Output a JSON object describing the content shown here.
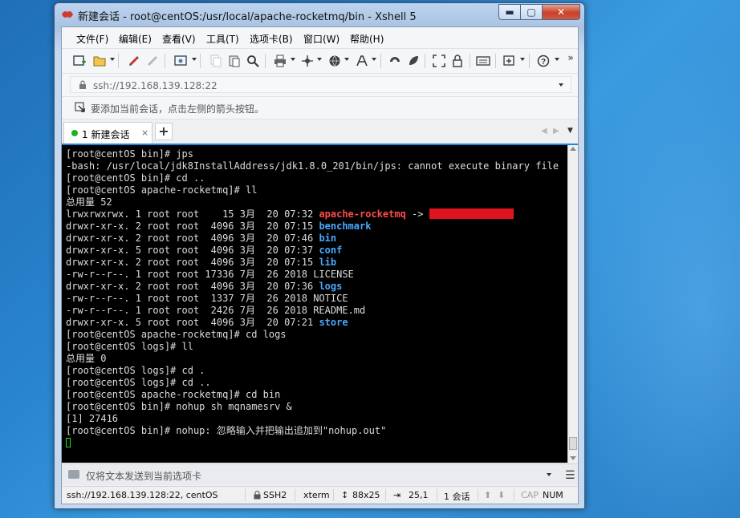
{
  "window": {
    "title": "新建会话 - root@centOS:/usr/local/apache-rocketmq/bin - Xshell 5",
    "controls": {
      "minimize": "▬",
      "maximize": "▢",
      "close": "✕"
    }
  },
  "menu": {
    "items": [
      "文件(F)",
      "编辑(E)",
      "查看(V)",
      "工具(T)",
      "选项卡(B)",
      "窗口(W)",
      "帮助(H)"
    ]
  },
  "toolbar": {
    "icons": [
      "new-session-icon",
      "open-folder-icon",
      "connect-icon",
      "disconnect-icon",
      "properties-icon",
      "copy-icon",
      "paste-icon",
      "find-icon",
      "print-icon",
      "transfer-icon",
      "globe-icon",
      "font-icon",
      "xftp-icon",
      "script-icon",
      "fullscreen-icon",
      "lock-icon",
      "keyboard-icon",
      "add-icon",
      "help-icon"
    ],
    "overflow": "»"
  },
  "address": {
    "value": "ssh://192.168.139.128:22"
  },
  "hint": {
    "text": "要添加当前会话，点击左侧的箭头按钮。"
  },
  "tabs": {
    "items": [
      {
        "label": "1 新建会话",
        "close": "×"
      }
    ],
    "add": "+",
    "prev": "◀",
    "next": "▶",
    "menu": "▼"
  },
  "terminal": {
    "prompt_color": "#dcdcdc",
    "red_color": "#ff4b4b",
    "blue_color": "#4aa8ff",
    "lines": [
      "[root@centOS bin]# jps",
      "-bash: /usr/local/jdk8InstallAddress/jdk1.8.0_201/bin/jps: cannot execute binary file",
      "[root@centOS bin]# cd ..",
      "[root@centOS apache-rocketmq]# ll",
      "总用量 52",
      "lrwxrwxrwx. 1 root root    15 3月  20 07:32 ",
      "drwxr-xr-x. 2 root root  4096 3月  20 07:15 ",
      "drwxr-xr-x. 2 root root  4096 3月  20 07:46 ",
      "drwxr-xr-x. 5 root root  4096 3月  20 07:37 ",
      "drwxr-xr-x. 2 root root  4096 3月  20 07:15 ",
      "-rw-r--r--. 1 root root 17336 7月  26 2018 LICENSE",
      "drwxr-xr-x. 2 root root  4096 3月  20 07:36 ",
      "-rw-r--r--. 1 root root  1337 7月  26 2018 NOTICE",
      "-rw-r--r--. 1 root root  2426 7月  26 2018 README.md",
      "drwxr-xr-x. 5 root root  4096 3月  20 07:21 ",
      "[root@centOS apache-rocketmq]# cd logs",
      "[root@centOS logs]# ll",
      "总用量 0",
      "[root@centOS logs]# cd .",
      "[root@centOS logs]# cd ..",
      "[root@centOS apache-rocketmq]# cd bin",
      "[root@centOS bin]# nohup sh mqnamesrv &",
      "[1] 27416",
      "[root@centOS bin]# nohup: 忽略输入并把输出追加到\"nohup.out\""
    ],
    "symlink_name": "apache-rocketmq",
    "symlink_arrow": " -> ",
    "dirs": {
      "benchmark": "benchmark",
      "bin": "bin",
      "conf": "conf",
      "lib": "lib",
      "logs": "logs",
      "store": "store"
    }
  },
  "sendbar": {
    "placeholder": "仅将文本发送到当前选项卡",
    "menu": "☰"
  },
  "status": {
    "connection": "ssh://192.168.139.128:22, centOS",
    "protocol": "SSH2",
    "term": "xterm",
    "size": "88x25",
    "position": "25,1",
    "sessions": "1 会话",
    "cap": "CAP",
    "num": "NUM"
  }
}
